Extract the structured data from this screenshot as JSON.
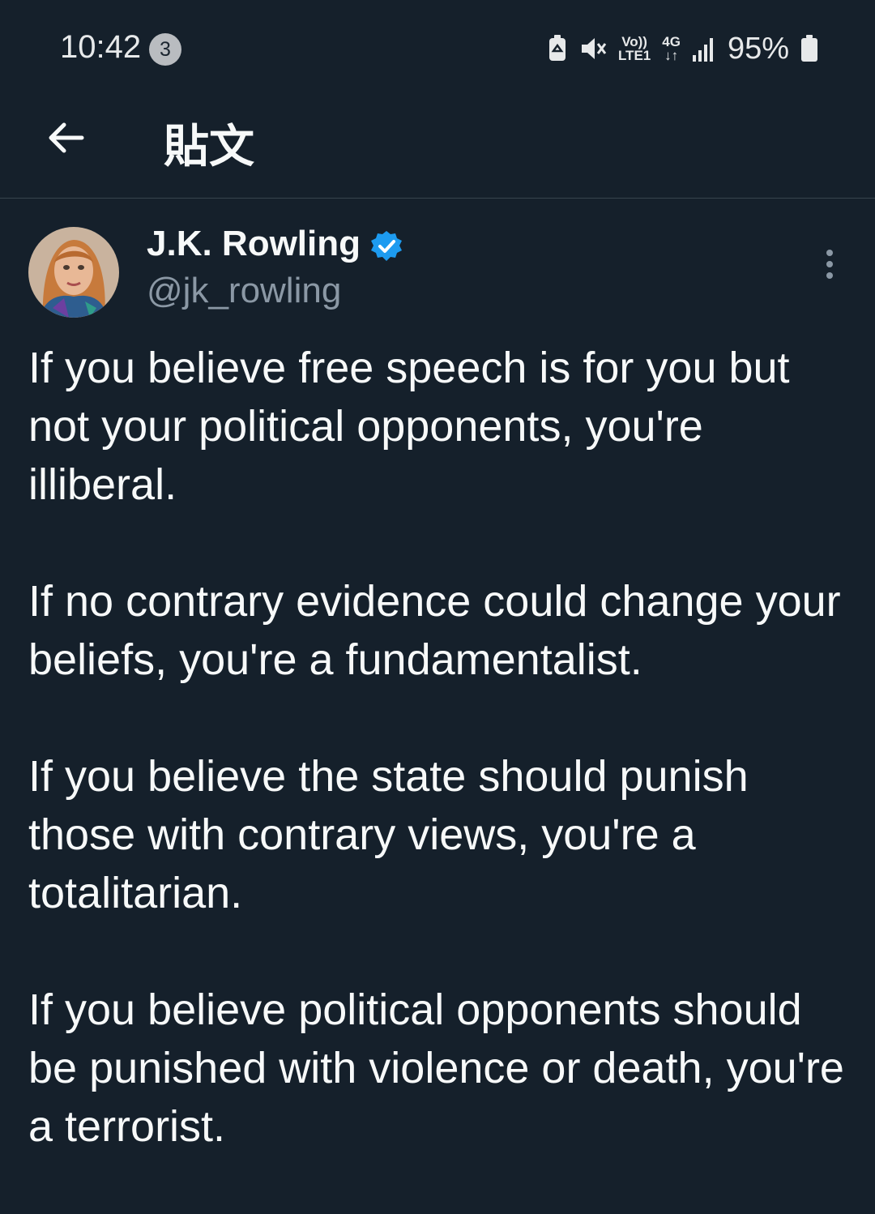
{
  "status_bar": {
    "time": "10:42",
    "notification_count": "3",
    "volte": "Vo))",
    "lte": "LTE1",
    "network": "4G",
    "battery_percent": "95%"
  },
  "toolbar": {
    "title": "貼文"
  },
  "post": {
    "author_name": "J.K. Rowling",
    "handle": "@jk_rowling",
    "paragraphs": [
      "If you believe free speech is for you but not your political opponents, you're illiberal.",
      "If no contrary evidence could change your beliefs, you're a fundamentalist.",
      "If you believe the state should punish those with contrary views, you're a totalitarian.",
      "If you believe political opponents should be punished with violence or death, you're a terrorist."
    ]
  },
  "colors": {
    "background": "#15202b",
    "text": "#f7f9f9",
    "secondary_text": "#8b98a5",
    "verified": "#1d9bf0",
    "divider": "#38444d"
  }
}
